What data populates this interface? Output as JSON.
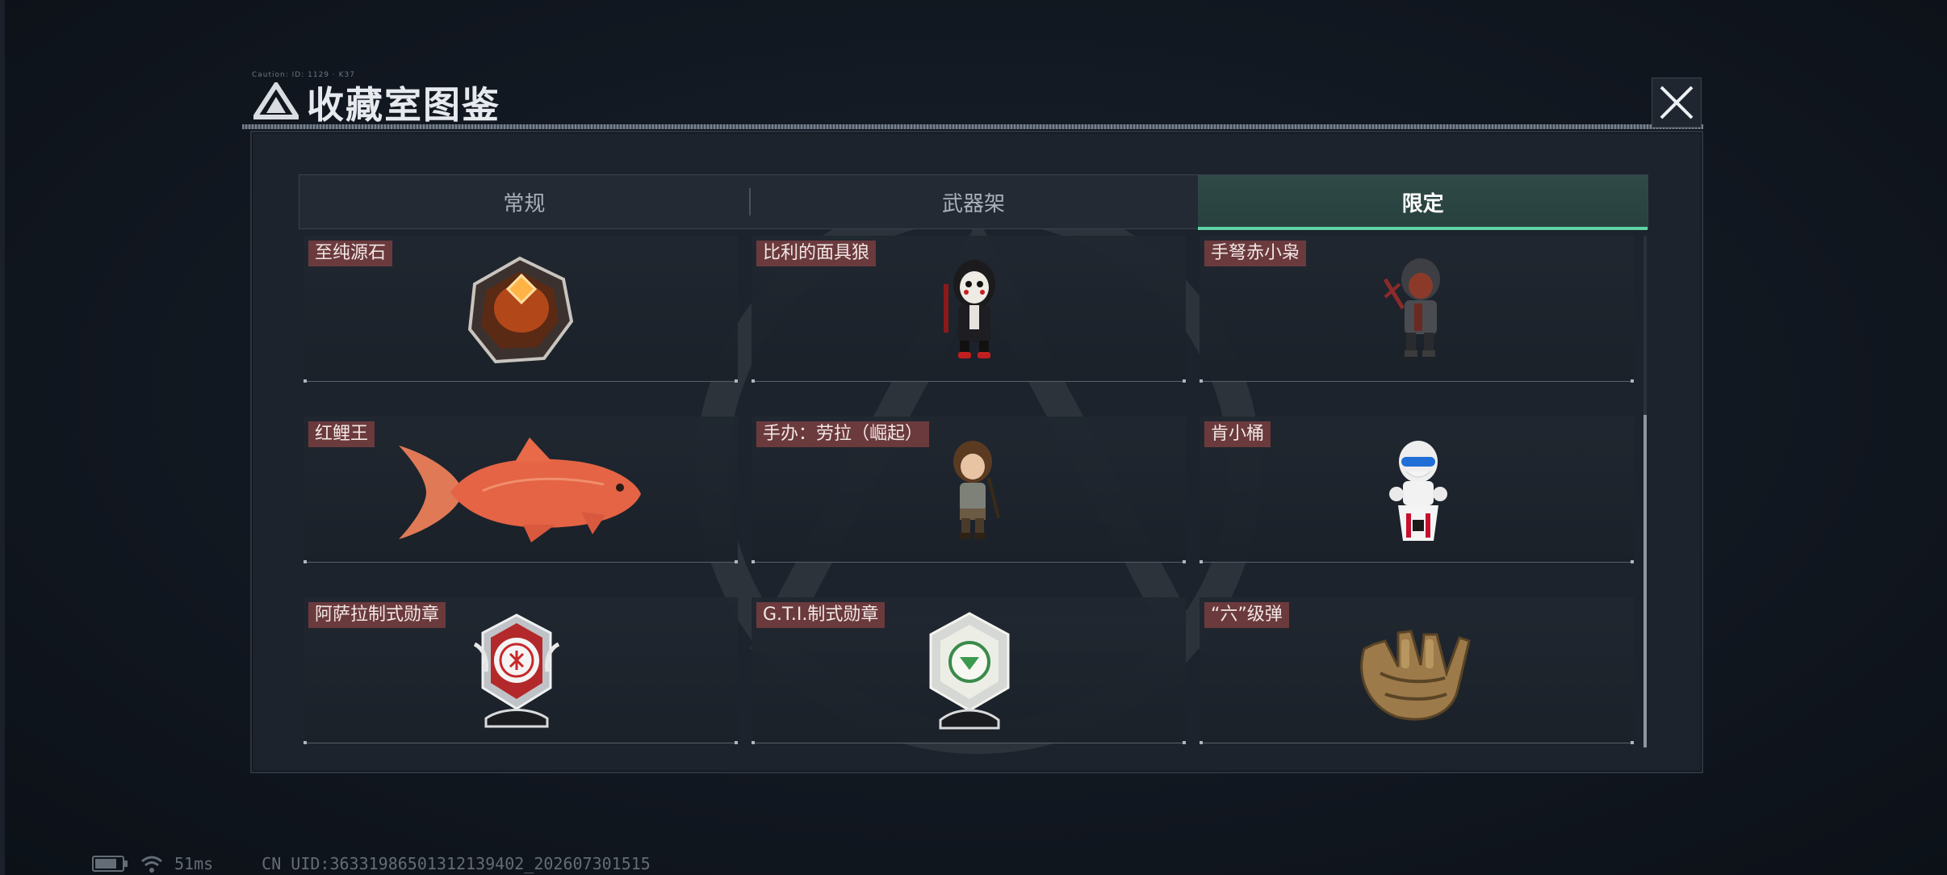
{
  "header": {
    "title": "收藏室图鉴",
    "caption": "Caution: ID: 1129 · K37"
  },
  "tabs": [
    {
      "label": "常规",
      "active": false
    },
    {
      "label": "武器架",
      "active": false
    },
    {
      "label": "限定",
      "active": true
    }
  ],
  "items": [
    {
      "label": "至纯源石",
      "icon": "originium-crystal-icon"
    },
    {
      "label": "比利的面具狼",
      "icon": "billy-mask-figure-icon"
    },
    {
      "label": "手弩赤小枭",
      "icon": "crossbow-owl-figure-icon"
    },
    {
      "label": "红鲤王",
      "icon": "red-carp-icon"
    },
    {
      "label": "手办：劳拉（崛起）",
      "icon": "lara-figure-icon"
    },
    {
      "label": "肯小桶",
      "icon": "bucket-mascot-icon"
    },
    {
      "label": "阿萨拉制式勋章",
      "icon": "asala-medal-icon"
    },
    {
      "label": "G.T.I.制式勋章",
      "icon": "gti-medal-icon"
    },
    {
      "label": "“六”级弹",
      "icon": "golden-hand-icon"
    }
  ],
  "status": {
    "ping": "51ms",
    "uid": "CN UID:36331986501312139402_202607301515"
  },
  "colors": {
    "accent": "#5fd3a4",
    "label_bg": "#6b3a3d",
    "panel_bg": "#1c232c"
  }
}
